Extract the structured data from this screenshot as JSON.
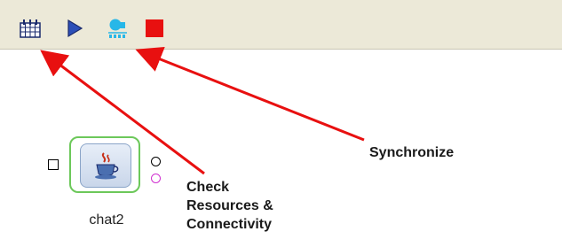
{
  "toolbar": {
    "buttons": [
      {
        "name": "check-resources",
        "icon": "grid-calendar-icon"
      },
      {
        "name": "run",
        "icon": "play-triangle-icon"
      },
      {
        "name": "synchronize",
        "icon": "sync-network-icon"
      },
      {
        "name": "stop",
        "icon": "stop-square-icon"
      }
    ]
  },
  "component": {
    "label": "chat2",
    "icon": "java-cup-icon",
    "border_color": "#6cc85a"
  },
  "callouts": {
    "synchronize": "Synchronize",
    "check_line1": "Check",
    "check_line2": "Resources &",
    "check_line3": "Connectivity"
  },
  "colors": {
    "arrow": "#e81010",
    "stop": "#e81010",
    "run": "#2c4fb8",
    "sync": "#27b7e8",
    "toolbar_bg": "#ece9d8"
  }
}
